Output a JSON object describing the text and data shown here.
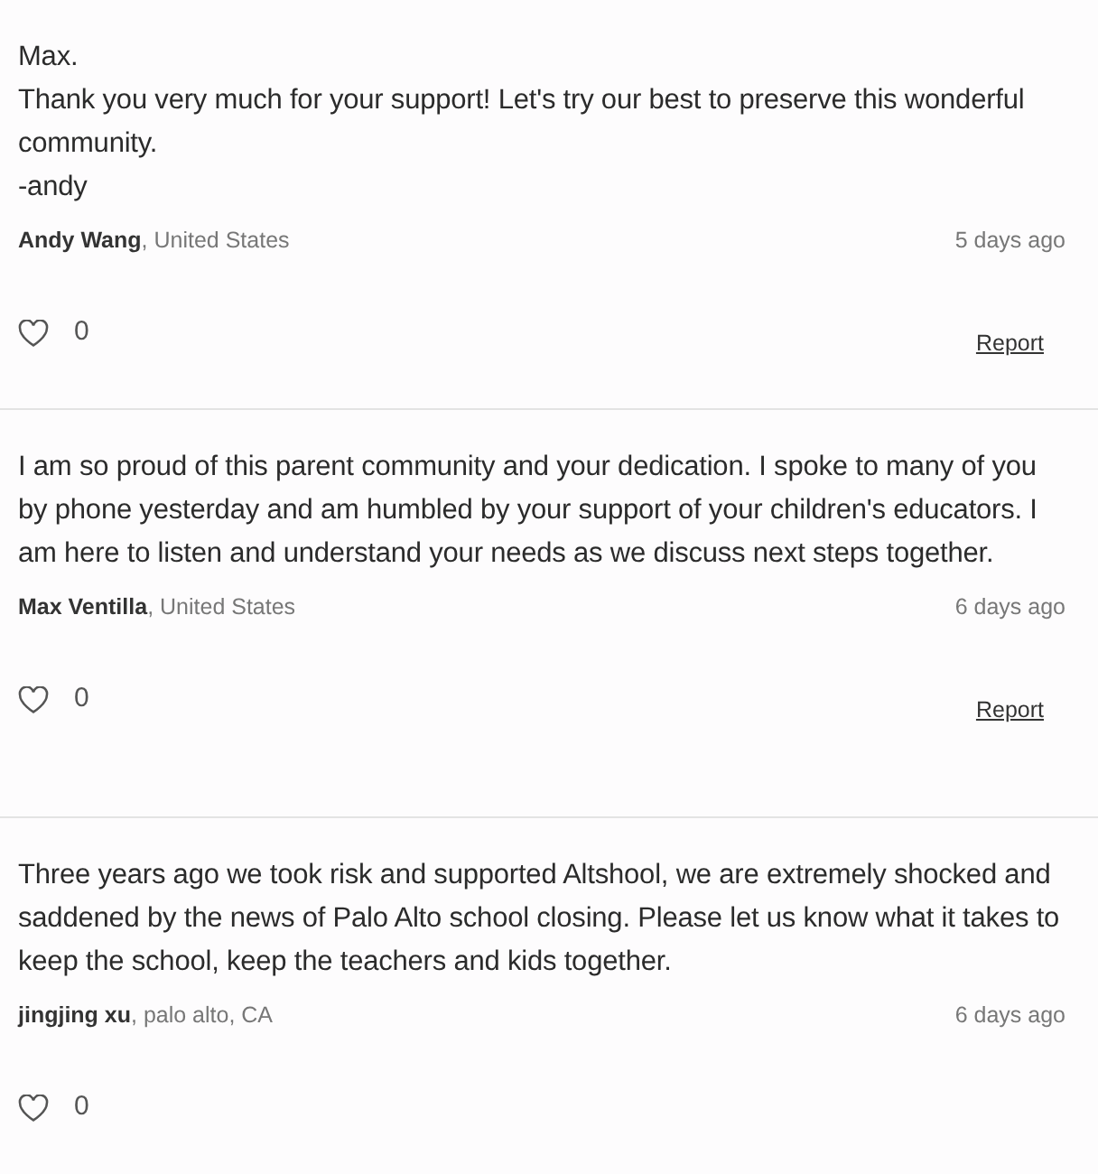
{
  "comments": [
    {
      "text": "Max.\nThank you very much for your support! Let's try our best to preserve this wonderful community.\n-andy",
      "author": "Andy Wang",
      "location": ", United States",
      "time": "5 days ago",
      "likes": "0",
      "report": "Report"
    },
    {
      "text": "I am so proud of this parent community and your dedication. I spoke to many of you by phone yesterday and am humbled by your support of your children's educators. I am here to listen and understand your needs as we discuss next steps together.",
      "author": "Max Ventilla",
      "location": ", United States",
      "time": "6 days ago",
      "likes": "0",
      "report": "Report"
    },
    {
      "text": "Three years ago we took risk and supported Altshool, we are extremely shocked and saddened by the news of Palo Alto school closing. Please let us know what it takes to keep the school, keep the teachers and kids together.",
      "author": "jingjing xu",
      "location": ", palo alto, CA",
      "time": "6 days ago",
      "likes": "0"
    }
  ]
}
